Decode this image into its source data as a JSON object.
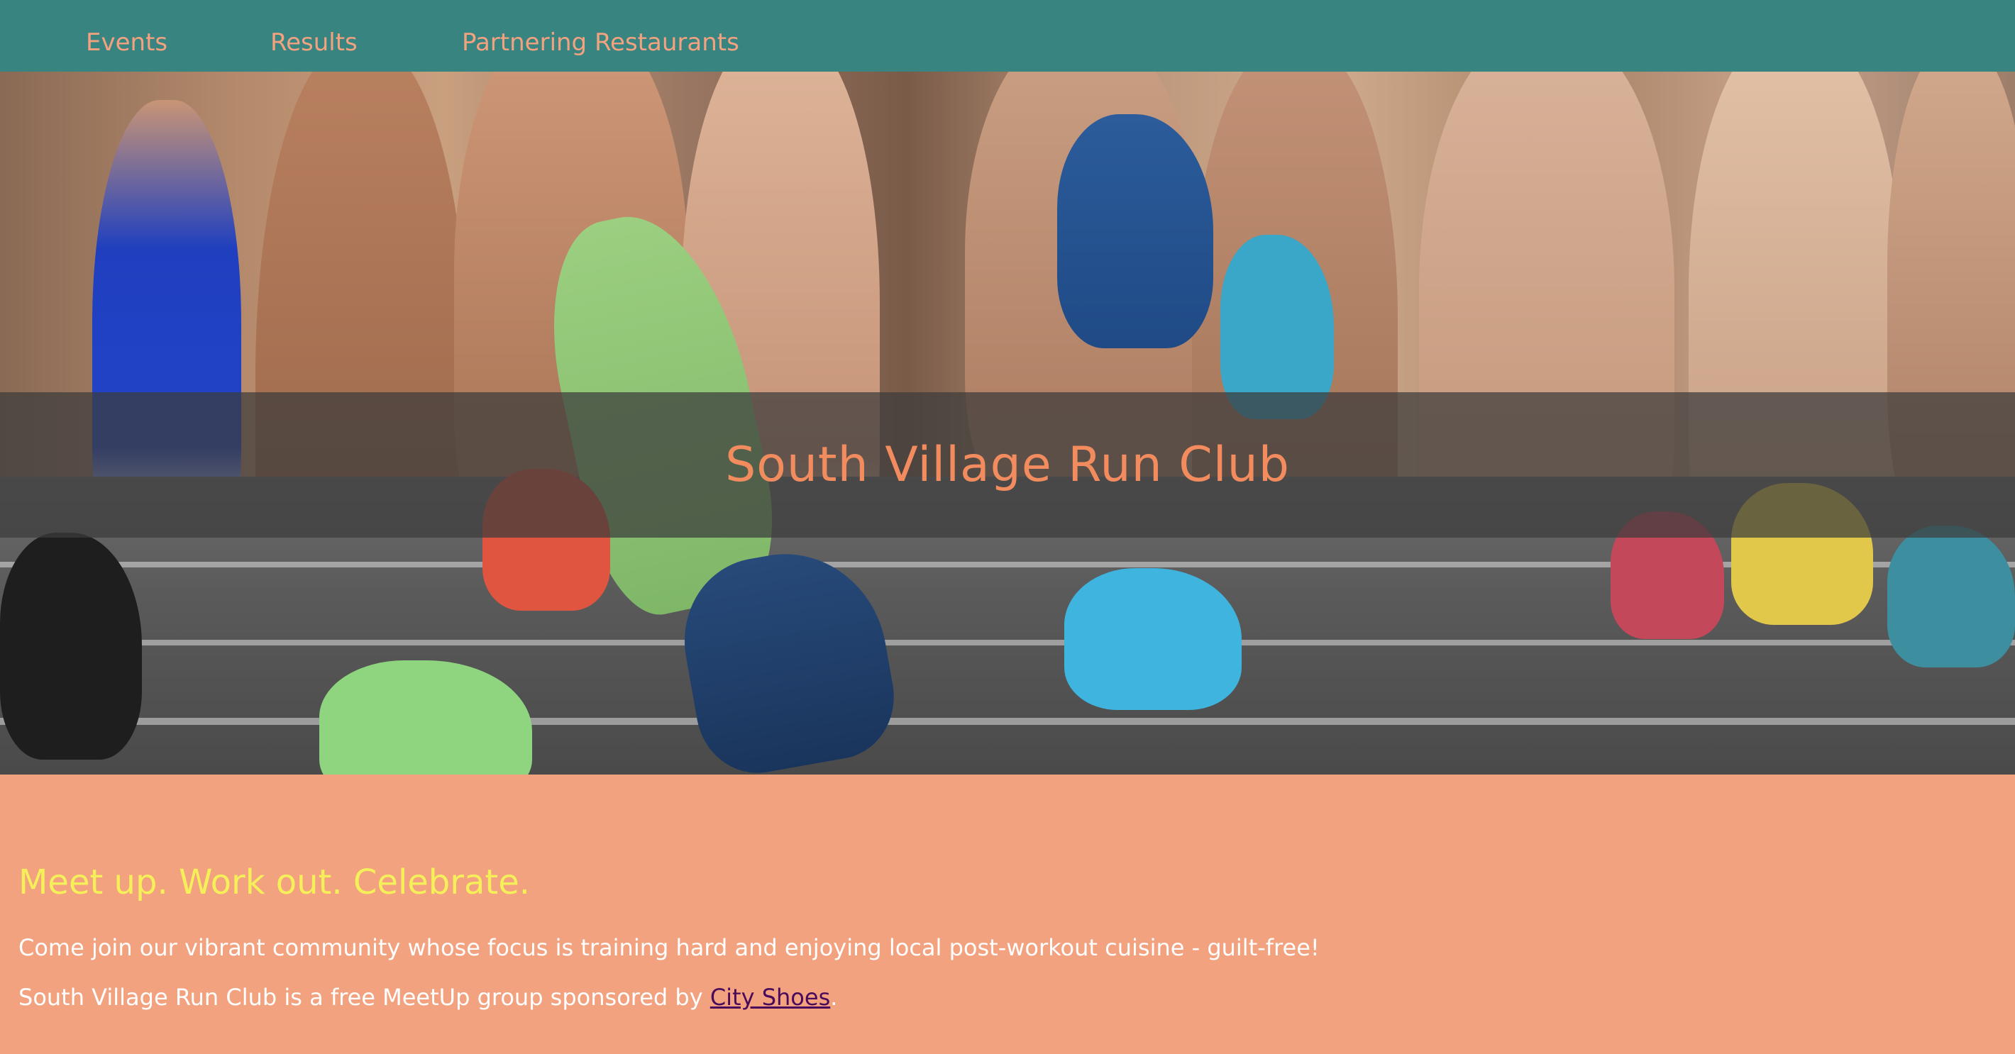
{
  "nav": {
    "items": [
      {
        "label": "Events"
      },
      {
        "label": "Results"
      },
      {
        "label": "Partnering Restaurants"
      }
    ]
  },
  "hero": {
    "title": "South Village Run Club"
  },
  "content": {
    "tagline": "Meet up. Work out. Celebrate.",
    "paragraph_1": "Come join our vibrant community whose focus is training hard and enjoying local post-workout cuisine - guilt-free!",
    "paragraph_2_prefix": "South Village Run Club is a free MeetUp group sponsored by ",
    "sponsor_link": "City Shoes",
    "paragraph_2_suffix": "."
  },
  "colors": {
    "nav_bg": "#388481",
    "nav_text": "#f2a27f",
    "title_text": "#f28c5e",
    "content_bg": "#f2a27f",
    "tagline": "#f5f05a",
    "link": "#4a0a5c"
  }
}
